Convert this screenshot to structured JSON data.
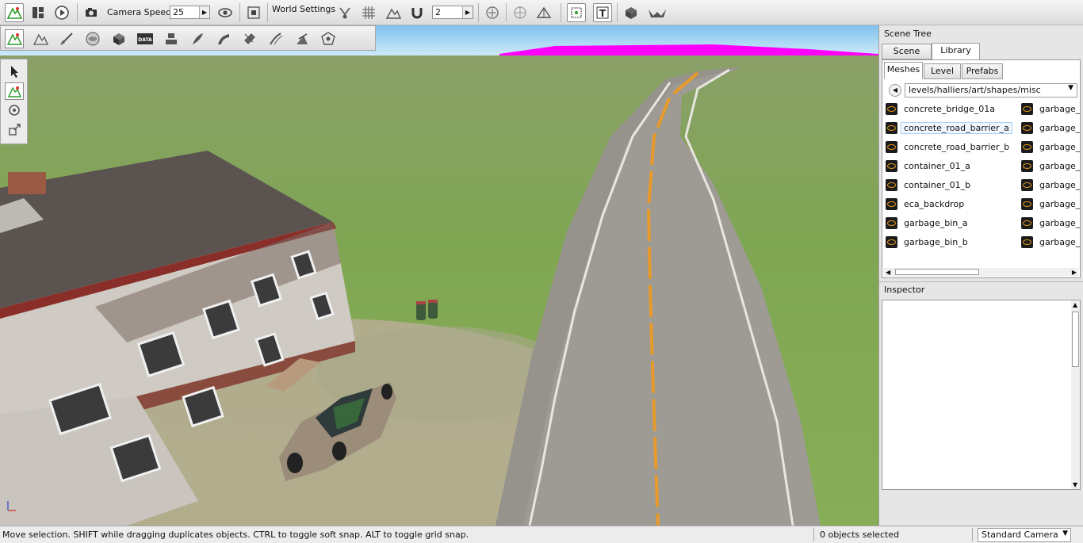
{
  "toolbar": {
    "camera_speed_label": "Camera Speed",
    "camera_speed_value": "25",
    "world_settings_label": "World Settings",
    "grid_snap_value": "2"
  },
  "scene_tree": {
    "title": "Scene Tree",
    "tabs": [
      "Scene",
      "Library"
    ],
    "active_tab": "Library",
    "sub_tabs": [
      "Meshes",
      "Level",
      "Prefabs"
    ],
    "active_sub_tab": "Meshes",
    "path": "levels/halliers/art/shapes/misc",
    "meshes_col1": [
      "concrete_bridge_01a",
      "concrete_road_barrier_a",
      "concrete_road_barrier_b",
      "container_01_a",
      "container_01_b",
      "eca_backdrop",
      "garbage_bin_a",
      "garbage_bin_b"
    ],
    "meshes_col2": [
      "garbage_bu",
      "garbage_bu",
      "garbage_ca",
      "garbage_ca",
      "garbage_lit",
      "garbage_pl",
      "garbage_pl",
      "garbage_sa"
    ],
    "selected_mesh": "concrete_road_barrier_a"
  },
  "inspector": {
    "title": "Inspector"
  },
  "status": {
    "hint": "Move selection.  SHIFT while dragging duplicates objects.  CTRL to toggle soft snap.  ALT to toggle grid snap.",
    "selection_count": "0 objects selected",
    "camera_mode": "Standard Camera"
  }
}
